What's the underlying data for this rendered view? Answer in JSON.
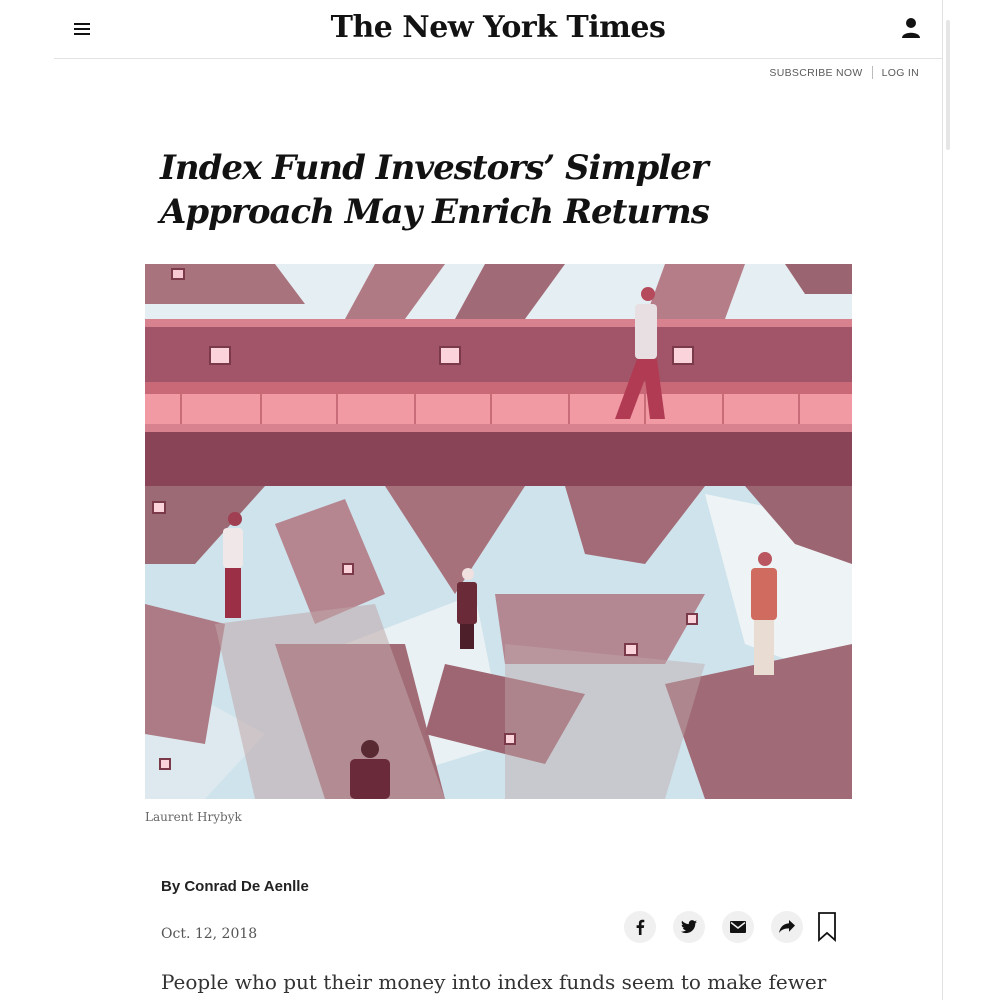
{
  "masthead": {
    "logo_text": "The New York Times",
    "menu_icon": "hamburger-menu-icon",
    "user_icon": "user-icon"
  },
  "account": {
    "subscribe_label": "SUBSCRIBE NOW",
    "login_label": "LOG IN"
  },
  "article": {
    "headline": "Index Fund Investors’ Simpler Approach May Enrich Returns",
    "image_credit": "Laurent Hrybyk",
    "byline": "By Conrad De Aenlle",
    "date": "Oct. 12, 2018",
    "lede": "People who put their money into index funds seem to make fewer"
  },
  "share": {
    "icons": [
      "facebook-icon",
      "twitter-icon",
      "email-icon",
      "share-icon",
      "bookmark-icon"
    ]
  },
  "colors": {
    "text": "#121212",
    "meta": "#5a5a5a",
    "share_bg": "#f0f0f0",
    "illustration_rose": "#c0566a",
    "illustration_mauve": "#8d4e5c",
    "illustration_sky": "#cfe3ec"
  }
}
